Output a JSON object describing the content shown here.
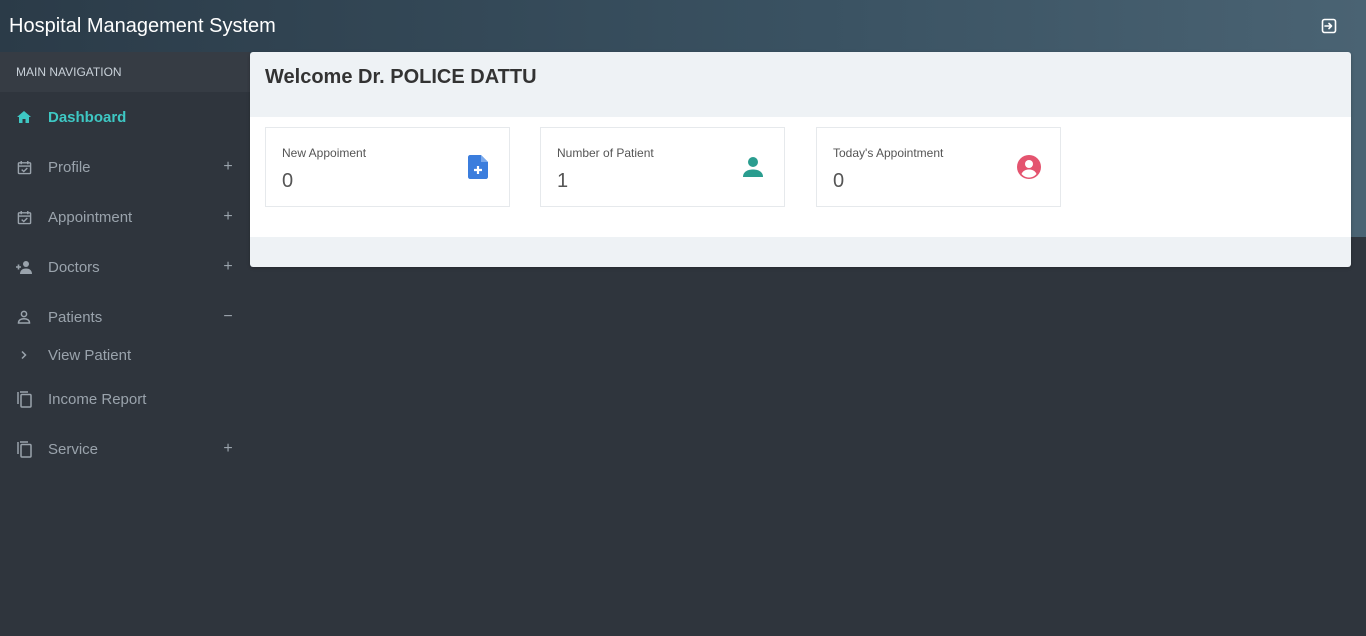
{
  "app": {
    "title": "Hospital Management System"
  },
  "sidebar": {
    "header": "MAIN NAVIGATION",
    "items": [
      {
        "label": "Dashboard",
        "icon": "home-icon",
        "toggle": ""
      },
      {
        "label": "Profile",
        "icon": "calendar-check-icon",
        "toggle": "+"
      },
      {
        "label": "Appointment",
        "icon": "calendar-check-icon",
        "toggle": "+"
      },
      {
        "label": "Doctors",
        "icon": "person-add-icon",
        "toggle": "+"
      },
      {
        "label": "Patients",
        "icon": "person-outline-icon",
        "toggle": "−"
      },
      {
        "label": "View Patient",
        "icon": "chevron-right-icon",
        "toggle": ""
      },
      {
        "label": "Income Report",
        "icon": "copy-icon",
        "toggle": ""
      },
      {
        "label": "Service",
        "icon": "copy-icon",
        "toggle": "+"
      }
    ]
  },
  "main": {
    "welcome": "Welcome Dr. POLICE DATTU",
    "cards": [
      {
        "label": "New Appoiment",
        "value": "0",
        "icon": "file-plus-icon",
        "color": "#3b7ddd"
      },
      {
        "label": "Number of Patient",
        "value": "1",
        "icon": "person-icon",
        "color": "#2a9d8f"
      },
      {
        "label": "Today's Appointment",
        "value": "0",
        "icon": "account-circle-icon",
        "color": "#e4546f"
      }
    ]
  },
  "colors": {
    "accent": "#3ec8c4",
    "sidebar_bg": "#2f353d",
    "header_gradient_start": "#2b3b48",
    "header_gradient_end": "#4a6373"
  }
}
